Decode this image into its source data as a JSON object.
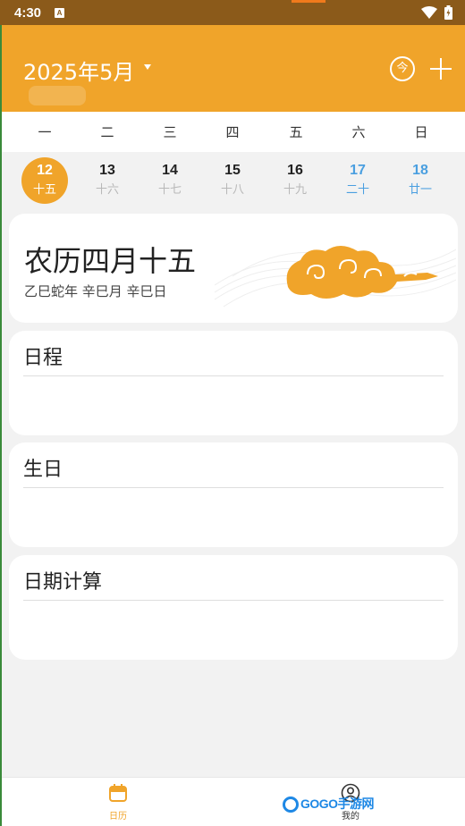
{
  "status": {
    "time": "4:30",
    "notif_badge": "A"
  },
  "header": {
    "title": "2025年5月",
    "today_label": "今",
    "colors": {
      "primary": "#f0a42a",
      "status": "#8b5a1a"
    }
  },
  "week_headers": [
    "一",
    "二",
    "三",
    "四",
    "五",
    "六",
    "日"
  ],
  "days": [
    {
      "num": "12",
      "lunar": "十五"
    },
    {
      "num": "13",
      "lunar": "十六"
    },
    {
      "num": "14",
      "lunar": "十七"
    },
    {
      "num": "15",
      "lunar": "十八"
    },
    {
      "num": "16",
      "lunar": "十九"
    },
    {
      "num": "17",
      "lunar": "二十"
    },
    {
      "num": "18",
      "lunar": "廿一"
    }
  ],
  "lunar_card": {
    "title": "农历四月十五",
    "subtitle": "乙巳蛇年  辛巳月  辛巳日"
  },
  "sections": [
    {
      "title": "日程"
    },
    {
      "title": "生日"
    },
    {
      "title": "日期计算"
    }
  ],
  "tabs": {
    "calendar": "日历",
    "me": "我的"
  },
  "watermark": "GOGO手游网"
}
